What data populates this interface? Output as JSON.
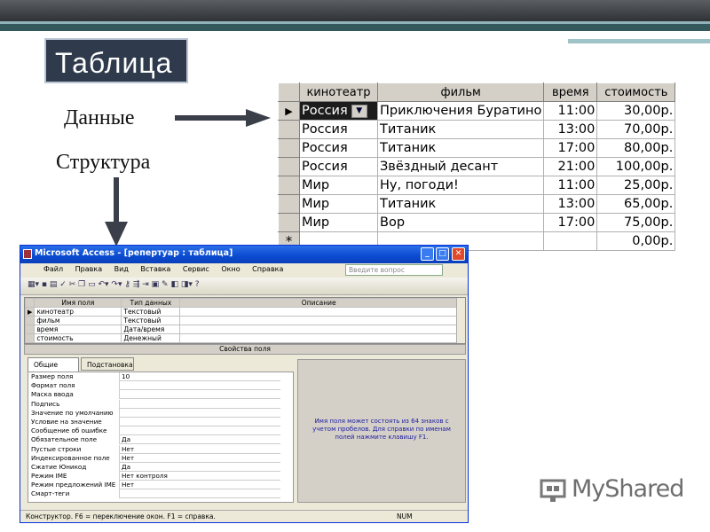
{
  "slide": {
    "title": "Таблица",
    "label_data": "Данные",
    "label_structure": "Структура"
  },
  "data_table": {
    "headers": [
      "кинотеатр",
      "фильм",
      "время",
      "стоимость"
    ],
    "rows": [
      [
        "Россия",
        "Приключения Буратино",
        "11:00",
        "30,00р."
      ],
      [
        "Россия",
        "Титаник",
        "13:00",
        "70,00р."
      ],
      [
        "Россия",
        "Титаник",
        "17:00",
        "80,00р."
      ],
      [
        "Россия",
        "Звёздный десант",
        "21:00",
        "100,00р."
      ],
      [
        "Мир",
        "Ну, погоди!",
        "11:00",
        "25,00р."
      ],
      [
        "Мир",
        "Титаник",
        "13:00",
        "65,00р."
      ],
      [
        "Мир",
        "Вор",
        "17:00",
        "75,00р."
      ]
    ],
    "new_row_marker": "*",
    "new_row_cost": "0,00р.",
    "current_row_marker": "▶"
  },
  "access_window": {
    "title": "Microsoft Access - [репертуар : таблица]",
    "menu": [
      "Файл",
      "Правка",
      "Вид",
      "Вставка",
      "Сервис",
      "Окно",
      "Справка"
    ],
    "question_placeholder": "Введите вопрос",
    "design_headers": [
      "Имя поля",
      "Тип данных",
      "Описание"
    ],
    "fields": [
      [
        "кинотеатр",
        "Текстовый"
      ],
      [
        "фильм",
        "Текстовый"
      ],
      [
        "время",
        "Дата/время"
      ],
      [
        "стоимость",
        "Денежный"
      ]
    ],
    "properties_title": "Свойства поля",
    "tabs": [
      "Общие",
      "Подстановка"
    ],
    "properties": [
      [
        "Размер поля",
        "10"
      ],
      [
        "Формат поля",
        ""
      ],
      [
        "Маска ввода",
        ""
      ],
      [
        "Подпись",
        ""
      ],
      [
        "Значение по умолчанию",
        ""
      ],
      [
        "Условие на значение",
        ""
      ],
      [
        "Сообщение об ошибке",
        ""
      ],
      [
        "Обязательное поле",
        "Да"
      ],
      [
        "Пустые строки",
        "Нет"
      ],
      [
        "Индексированное поле",
        "Нет"
      ],
      [
        "Сжатие Юникод",
        "Да"
      ],
      [
        "Режим IME",
        "Нет контроля"
      ],
      [
        "Режим предложений IME",
        "Нет"
      ],
      [
        "Смарт-теги",
        ""
      ]
    ],
    "hint": "Имя поля может состоять из 64 знаков с учетом пробелов. Для справки по именам полей нажмите клавишу F1.",
    "status_text": "Конструктор. F6 = переключение окон. F1 = справка.",
    "status_num": "NUM"
  },
  "brand": {
    "name": "MyShared"
  },
  "colors": {
    "title_bg": "#2f3b4d",
    "xp_blue": "#0a4bd0",
    "arrow": "#3a3f4a"
  }
}
